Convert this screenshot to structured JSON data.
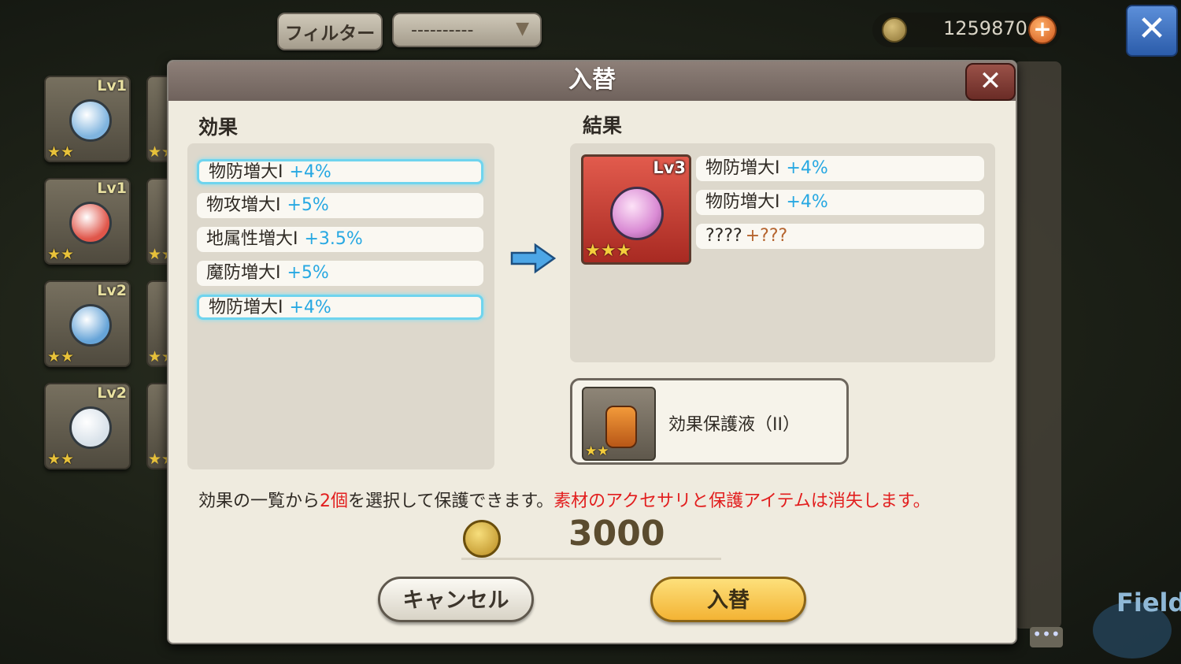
{
  "topbar": {
    "filter_label": "フィルター",
    "filter_select": "----------",
    "gold": "1259870",
    "plus": "+",
    "close": "✕"
  },
  "tiles": [
    {
      "level": "Lv1",
      "stars": "★★",
      "gem_color": "#7fb4df"
    },
    {
      "level": "Lv1",
      "stars": "★★",
      "gem_color": "#e0564a"
    },
    {
      "level": "Lv2",
      "stars": "★★",
      "gem_color": "#66a4d8"
    },
    {
      "level": "Lv2",
      "stars": "★★",
      "gem_color": "#d9e2ea"
    }
  ],
  "partial_stars": "★★",
  "dialog": {
    "title": "入替",
    "close": "✕",
    "effects_label": "効果",
    "result_label": "結果",
    "effects": [
      {
        "name": "物防増大Ⅰ",
        "value": "+4%",
        "selected": true
      },
      {
        "name": "物攻増大Ⅰ",
        "value": "+5%",
        "selected": false
      },
      {
        "name": "地属性増大Ⅰ",
        "value": "+3.5%",
        "selected": false
      },
      {
        "name": "魔防増大Ⅰ",
        "value": "+5%",
        "selected": false
      },
      {
        "name": "物防増大Ⅰ",
        "value": "+4%",
        "selected": true
      }
    ],
    "result_item": {
      "level": "Lv3",
      "stars": "★★★"
    },
    "results": [
      {
        "name": "物防増大Ⅰ",
        "value": "+4%"
      },
      {
        "name": "物防増大Ⅰ",
        "value": "+4%"
      },
      {
        "name": "????",
        "value": "+???"
      }
    ],
    "protect_item": {
      "name": "効果保護液（II）",
      "stars": "★★"
    },
    "info": {
      "part1": "効果の一覧から",
      "count": "2個",
      "part2": "を選択して保護できます。",
      "warning": "素材のアクセサリと保護アイテムは消失します。"
    },
    "cost": "3000",
    "cancel_label": "キャンセル",
    "swap_label": "入替"
  },
  "field_label": "Field",
  "chat_icon": "•••"
}
